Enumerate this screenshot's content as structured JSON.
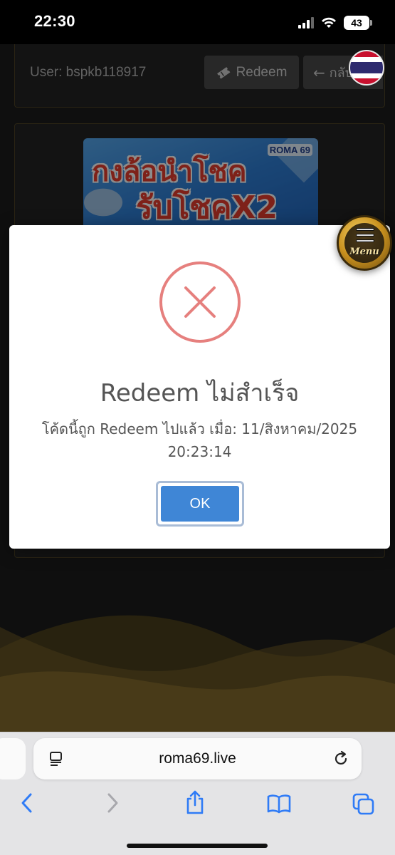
{
  "status_bar": {
    "time": "22:30",
    "battery": "43"
  },
  "header": {
    "user_label": "User: bspkb118917",
    "redeem_label": "Redeem",
    "back_label": "กลับ"
  },
  "banner": {
    "line1": "กงล้อนำโชค",
    "line2": "รับโชคX2",
    "logo_text": "ROMA 69"
  },
  "dialog": {
    "title": "Redeem ไม่สำเร็จ",
    "message_line1": "โค้ดนี้ถูก Redeem ไปแล้ว เมื่อ: 11/สิงหาคม/2025",
    "message_line2": "20:23:14",
    "ok_label": "OK",
    "icon": "error-x-icon"
  },
  "menu_fab": {
    "label": "Menu"
  },
  "browser": {
    "url": "roma69.live"
  },
  "colors": {
    "error_ring": "#e6807e",
    "ok_button": "#3f86d6",
    "accent_gold": "#c9911e"
  }
}
